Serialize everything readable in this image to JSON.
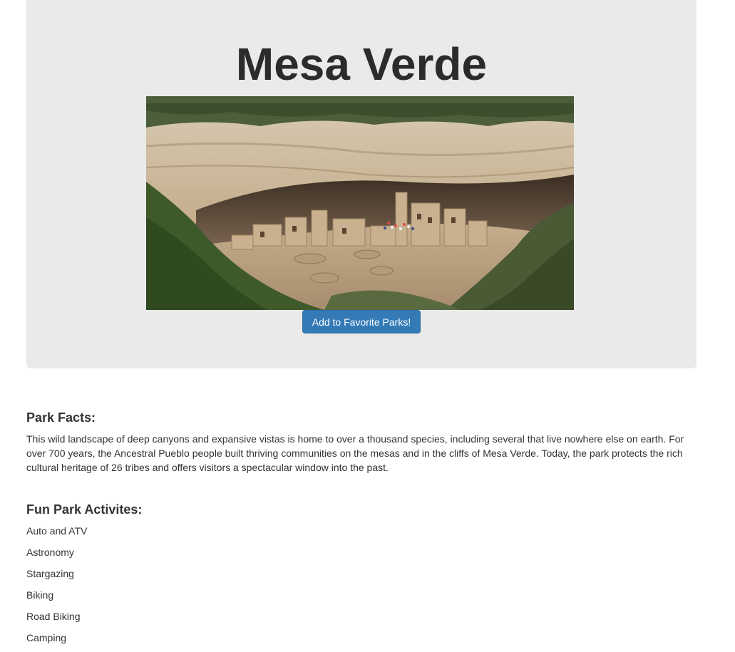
{
  "park": {
    "name": "Mesa Verde",
    "photo_alt": "Cliff Palace at Mesa Verde"
  },
  "actions": {
    "favorite_label": "Add to Favorite Parks!"
  },
  "facts": {
    "heading": "Park Facts:",
    "text": "This wild landscape of deep canyons and expansive vistas is home to over a thousand species, including several that live nowhere else on earth. For over 700 years, the Ancestral Pueblo people built thriving communities on the mesas and in the cliffs of Mesa Verde. Today, the park protects the rich cultural heritage of 26 tribes and offers visitors a spectacular window into the past."
  },
  "activities": {
    "heading": "Fun Park Activites:",
    "items": [
      "Auto and ATV",
      "Astronomy",
      "Stargazing",
      "Biking",
      "Road Biking",
      "Camping"
    ]
  },
  "colors": {
    "jumbotron_bg": "#eaeaea",
    "button_bg": "#337ab7",
    "text": "#333333"
  }
}
